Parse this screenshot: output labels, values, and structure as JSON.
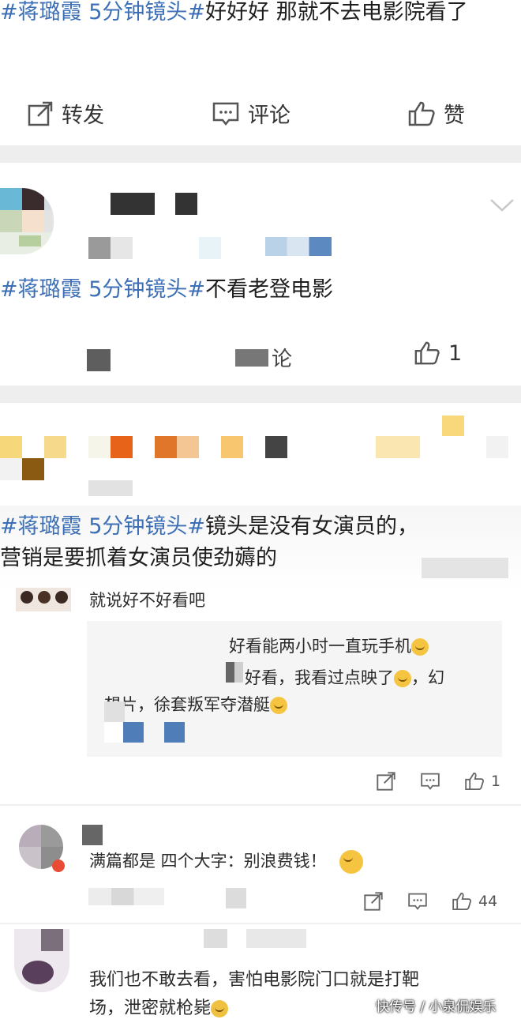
{
  "post1": {
    "tag": "#蒋璐霞 5分钟镜头#",
    "text": "好好好 那就不去电影院看了",
    "actions": {
      "repost": "转发",
      "comment": "评论",
      "like": "赞"
    }
  },
  "post2": {
    "tag": "#蒋璐霞 5分钟镜头#",
    "text": "不看老登电影",
    "comment_partial": "论",
    "like_count": "1"
  },
  "post3": {
    "tag": "#蒋璐霞 5分钟镜头#",
    "text_line1": "镜头是没有女演员的，",
    "text_line2": "营销是要抓着女演员使劲薅的"
  },
  "comment1": {
    "text": "就说好不好看吧",
    "reply1": "好看能两小时一直玩手机",
    "reply2_line1": "好看，我看过点映了",
    "reply2_tail": "，幻",
    "reply2_line2": "想片，徐套叛军夺潜艇",
    "like_count": "1"
  },
  "comment2": {
    "text": "满篇都是 四个大字：别浪费钱！",
    "like_count": "44"
  },
  "comment3": {
    "text_line1": "我们也不敢去看，害怕电影院门口就是打靶",
    "text_line2": "场，泄密就枪毙"
  },
  "watermark": "快传号 / 小泉侃娱乐",
  "colors": {
    "topic_blue": "#3c6fb5",
    "separator": "#eeeeee",
    "text": "#1e1e1e"
  }
}
